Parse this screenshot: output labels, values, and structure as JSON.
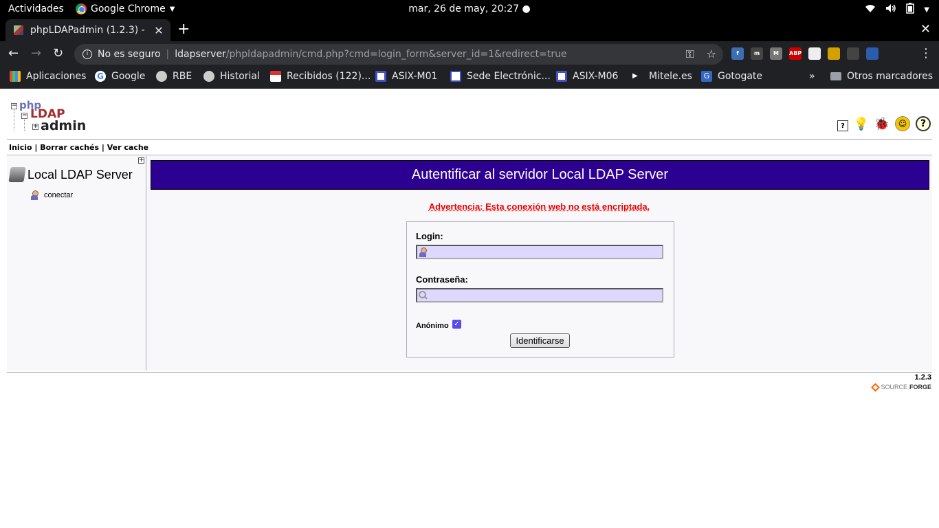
{
  "system": {
    "activities": "Actividades",
    "app_name": "Google Chrome",
    "clock": "mar, 26 de may, 20:27"
  },
  "browser": {
    "tab_title": "phpLDAPadmin (1.2.3) -",
    "security": "No es seguro",
    "url_host": "ldapserver",
    "url_path": "/phpldapadmin/cmd.php?cmd=login_form&server_id=1&redirect=true",
    "extensions": [
      {
        "name": "fedora-extension-icon",
        "color": "#3c6eb4",
        "text": "f"
      },
      {
        "name": "m-italic-extension-icon",
        "color": "#444",
        "text": "m"
      },
      {
        "name": "m-extension-icon",
        "color": "#777",
        "text": "M"
      },
      {
        "name": "adblock-plus-icon",
        "color": "#d10000",
        "text": "ABP"
      },
      {
        "name": "chart-extension-icon",
        "color": "#eee",
        "text": ""
      },
      {
        "name": "crown-extension-icon",
        "color": "#d4a000",
        "text": ""
      },
      {
        "name": "media-icon",
        "color": "#444",
        "text": ""
      },
      {
        "name": "profile-avatar-icon",
        "color": "#2a5caa",
        "text": ""
      }
    ]
  },
  "bookmarks": {
    "apps": "Aplicaciones",
    "items": [
      "Google",
      "RBE",
      "Historial",
      "Recibidos (122)...",
      "ASIX-M01",
      "Sede Electrónic...",
      "ASIX-M06",
      "Mitele.es",
      "Gotogate"
    ],
    "more": "»",
    "other": "Otros marcadores"
  },
  "app": {
    "logo": {
      "php": "php",
      "ldap": "LDAP",
      "admin": "admin"
    },
    "menu": {
      "home": "Inicio",
      "clear_cache": "Borrar cachés",
      "view_cache": "Ver cache",
      "separator": "|"
    },
    "tree": {
      "server_name": "Local LDAP Server",
      "connect": "conectar",
      "expand": "+"
    },
    "login": {
      "title": "Autentificar al servidor Local LDAP Server",
      "warning": "Advertencia: Esta conexión web no está encriptada.",
      "login_label": "Login:",
      "login_value": "",
      "password_label": "Contraseña:",
      "password_value": "",
      "anonymous_label": "Anónimo",
      "anonymous_checked": true,
      "submit": "Identificarse"
    },
    "footer": {
      "version": "1.2.3",
      "sf_light": "SOURCE",
      "sf_bold": "FORGE"
    }
  }
}
